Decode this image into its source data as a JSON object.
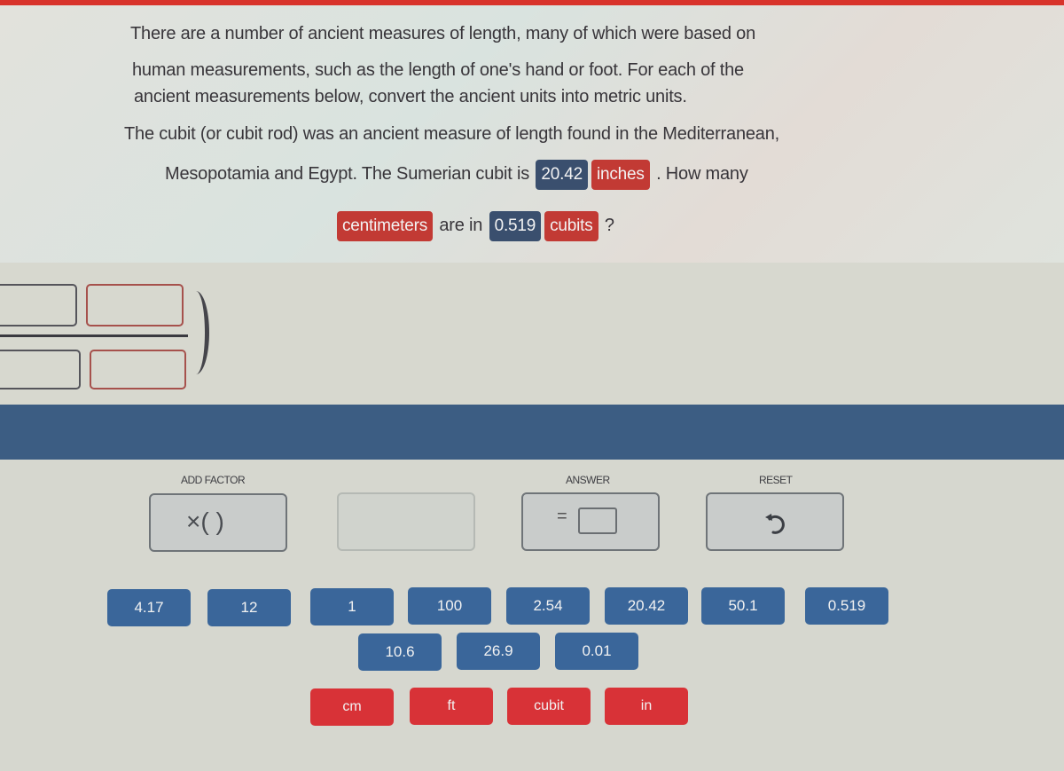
{
  "question": {
    "intro_lines": [
      "There are a number of ancient measures of length, many of which were based on",
      "human measurements, such as the length of one's hand or foot. For each of the",
      "ancient measurements below, convert the ancient units into metric units."
    ],
    "line4": "The cubit (or cubit rod) was an ancient measure of length found in the Mediterranean,",
    "line5_prefix": "Mesopotamia and Egypt. The Sumerian cubit is",
    "given_value": "20.42",
    "given_unit": "inches",
    "line5_suffix": ". How many",
    "target_unit": "centimeters",
    "line6_mid": "are in",
    "target_value": "0.519",
    "target_value_unit": "cubits",
    "line6_suffix": "?"
  },
  "colors": {
    "accent_red": "#d8332b",
    "number_chip": "#3a4f6e",
    "unit_chip": "#c23a34",
    "band_blue": "#3c5d83",
    "tile_blue": "#3a669a",
    "tile_red": "#d83237"
  },
  "controls": {
    "add_factor_label": "ADD FACTOR",
    "add_factor_symbol": "×( )",
    "answer_label": "ANSWER",
    "answer_symbol": "=",
    "reset_label": "RESET",
    "reset_icon": "undo-icon"
  },
  "tiles": {
    "row1": [
      "4.17",
      "12",
      "1",
      "100",
      "2.54",
      "20.42",
      "50.1",
      "0.519"
    ],
    "row2": [
      "10.6",
      "26.9",
      "0.01"
    ],
    "units": [
      "cm",
      "ft",
      "cubit",
      "in"
    ]
  }
}
